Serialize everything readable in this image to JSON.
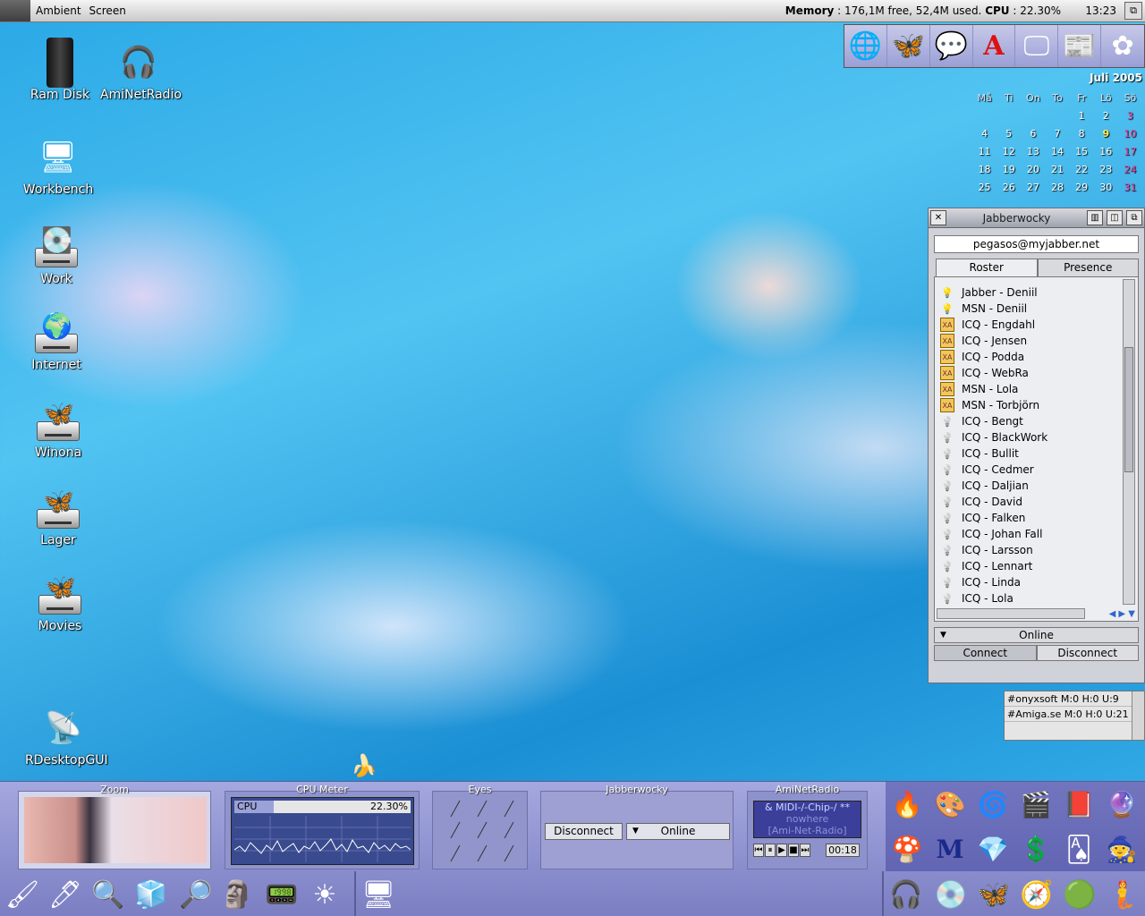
{
  "menubar": {
    "menu_items": [
      "Ambient",
      "Screen"
    ],
    "status_label": "Memory",
    "status_value": " : 176,1M free, 52,4M used.",
    "cpu_label": "CPU",
    "cpu_value": " : 22.30%",
    "clock": "13:23"
  },
  "desktop_icons": [
    {
      "label": "Ram Disk",
      "icon": "ramdisk-icon"
    },
    {
      "label": "AmiNetRadio",
      "icon": "headphones-icon"
    },
    {
      "label": "Workbench",
      "icon": "computer-icon"
    },
    {
      "label": "Work",
      "icon": "drive-icon"
    },
    {
      "label": "Internet",
      "icon": "drive-globe-icon"
    },
    {
      "label": "Winona",
      "icon": "drive-butterfly-icon"
    },
    {
      "label": "Lager",
      "icon": "drive-butterfly-icon"
    },
    {
      "label": "Movies",
      "icon": "drive-butterfly-icon"
    },
    {
      "label": "RDesktopGUI",
      "icon": "remote-desktop-icon"
    }
  ],
  "quicklaunch": [
    "globe-icon",
    "email-butterfly-icon",
    "chat-bubbles-icon",
    "amiga-a-icon",
    "terminal-icon",
    "newspaper-man-icon",
    "flower-icon"
  ],
  "calendar": {
    "month": "Juli",
    "year": "2005",
    "day_names": [
      "Må",
      "Ti",
      "On",
      "To",
      "Fr",
      "Lö",
      "Sö"
    ],
    "weeks": [
      [
        "",
        "",
        "",
        "",
        "1",
        "2",
        "3"
      ],
      [
        "4",
        "5",
        "6",
        "7",
        "8",
        "9",
        "10"
      ],
      [
        "11",
        "12",
        "13",
        "14",
        "15",
        "16",
        "17"
      ],
      [
        "18",
        "19",
        "20",
        "21",
        "22",
        "23",
        "24"
      ],
      [
        "25",
        "26",
        "27",
        "28",
        "29",
        "30",
        "31"
      ]
    ],
    "today": "9"
  },
  "jabber": {
    "title": "Jabberwocky",
    "account": "pegasos@myjabber.net",
    "tabs": [
      "Roster",
      "Presence"
    ],
    "contacts": [
      {
        "name": "Jabber - Deniil",
        "status": "online"
      },
      {
        "name": "MSN - Deniil",
        "status": "online"
      },
      {
        "name": "ICQ - Engdahl",
        "status": "xa"
      },
      {
        "name": "ICQ - Jensen",
        "status": "xa"
      },
      {
        "name": "ICQ - Podda",
        "status": "xa"
      },
      {
        "name": "ICQ - WebRa",
        "status": "xa"
      },
      {
        "name": "MSN - Lola",
        "status": "xa"
      },
      {
        "name": "MSN - Torbjörn",
        "status": "xa"
      },
      {
        "name": "ICQ - Bengt",
        "status": "offline"
      },
      {
        "name": "ICQ - BlackWork",
        "status": "offline"
      },
      {
        "name": "ICQ - Bullit",
        "status": "offline"
      },
      {
        "name": "ICQ - Cedmer",
        "status": "offline"
      },
      {
        "name": "ICQ - Daljian",
        "status": "offline"
      },
      {
        "name": "ICQ - David",
        "status": "offline"
      },
      {
        "name": "ICQ - Falken",
        "status": "offline"
      },
      {
        "name": "ICQ - Johan Fall",
        "status": "offline"
      },
      {
        "name": "ICQ - Larsson",
        "status": "offline"
      },
      {
        "name": "ICQ - Lennart",
        "status": "offline"
      },
      {
        "name": "ICQ - Linda",
        "status": "offline"
      },
      {
        "name": "ICQ - Lola",
        "status": "offline"
      }
    ],
    "status_select": "Online",
    "connect_label": "Connect",
    "disconnect_label": "Disconnect"
  },
  "irc": {
    "channels": [
      "#onyxsoft    M:0 H:0 U:9",
      "#Amiga.se  M:0 H:0 U:21"
    ]
  },
  "dock": {
    "zoom_title": "Zoom",
    "cpu_title": "CPU Meter",
    "cpu_label": "CPU",
    "cpu_value": "22.30%",
    "cpu_fraction": 0.223,
    "eyes_title": "Eyes",
    "jabber_title": "Jabberwocky",
    "jabber_disconnect": "Disconnect",
    "jabber_status": "Online",
    "radio_title": "AmiNetRadio",
    "radio_line1": "& MIDI-/-Chip-/ **",
    "radio_line2": "nowhere",
    "radio_line3": "[Ami-Net-Radio]",
    "radio_time": "00:18"
  },
  "dock_apps": [
    "fire-icon",
    "paint-icon",
    "spiral-icon",
    "clapper-icon",
    "book-icon",
    "sphere-icon",
    "mario-icon",
    "m-logo-icon",
    "gem-icon",
    "dollar-icon",
    "cards-icon",
    "lucas-icon"
  ],
  "launchbar": [
    "paint-brush-icon",
    "pen-icon",
    "magnifier-icon",
    "cube-icon",
    "search-icon",
    "tribal-icon",
    "monitor-icon",
    "sun-icon",
    "remote-desktop-icon",
    "headphones-icon",
    "mplayer-disc-icon",
    "butterfly-icon",
    "green-orb-icon",
    "girl-icon"
  ],
  "colors": {
    "accent": "#7b7fc3",
    "today": "#ffe94d",
    "sunday": "#ff3da0"
  }
}
